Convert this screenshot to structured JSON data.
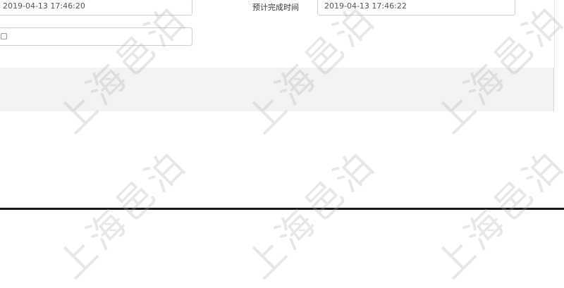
{
  "form": {
    "start_time_value": "2019-04-13 17:46:20",
    "end_time_label": "预计完成时间",
    "end_time_value": "2019-04-13 17:46:22",
    "checkbox_checked": false
  },
  "watermark": {
    "text": "上海邑泊"
  }
}
